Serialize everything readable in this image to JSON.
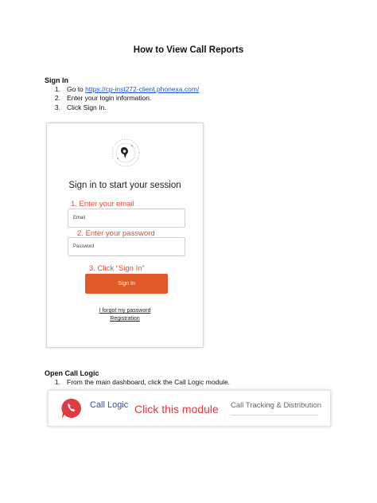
{
  "document": {
    "title": "How to View Call Reports",
    "sign_in": {
      "heading": "Sign In",
      "steps": [
        {
          "num": "1.",
          "prefix": "Go to ",
          "link": "https://cp-inst272-client.phonexa.com/"
        },
        {
          "num": "2.",
          "text": "Enter your login information."
        },
        {
          "num": "3.",
          "text": "Click Sign In."
        }
      ]
    },
    "login_screenshot": {
      "heading": "Sign in to start your session",
      "note_email": "1. Enter your email",
      "email_placeholder": "Email",
      "note_password": "2. Enter your password",
      "password_placeholder": "Password",
      "note_signin": "3. Click “Sign In”",
      "signin_label": "Sign In",
      "forgot_link": "I forgot my password",
      "registration_link": "Registration"
    },
    "open_call_logic": {
      "heading": "Open Call Logic",
      "steps": [
        {
          "num": "1.",
          "text": "From the main dashboard, click the Call Logic module."
        }
      ]
    },
    "module_screenshot": {
      "name": "Call Logic",
      "annotation": "Click this module",
      "description": "Call Tracking & Distribution"
    }
  },
  "colors": {
    "link": "#1a56c9",
    "annotation_red": "#e24a3b",
    "signin_button": "#e05a28",
    "module_title": "#3b4d8c"
  }
}
